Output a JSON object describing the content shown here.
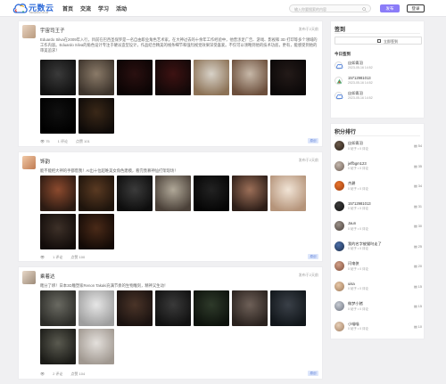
{
  "header": {
    "logo_title": "元数云",
    "logo_sub": "Metadata Cloud",
    "nav": [
      "首页",
      "交流",
      "学习",
      "活动"
    ],
    "search_placeholder": "输入你要搜索的内容",
    "publish_label": "发布",
    "login_label": "登录"
  },
  "posts": [
    {
      "user": "宇宙司王子",
      "date": "发布于2天前",
      "text": "Eduardo Silva在2009年入行，目前在巴西圣保罗是一名自由职业角色艺术家。在大神过去的十余年工作经验中，他曾涉足广告、游戏、影视和 3D 打印等多个领域的工作内容。Eduardo Silva的角色设计专注于硬派造型设计，作品结合精美的线条细节和强烈视觉效果深受喜爱。不仅可以领略到他的技术功底，更有，能感受到他的审美追求！",
      "views": "75",
      "comments": "1 评论",
      "likes": "点赞 101",
      "tag": "原创",
      "images": [
        [
          "#3a3a3a",
          "#111"
        ],
        [
          "#8a7a68",
          "#3d342c"
        ],
        [
          "#2a1010",
          "#0b0404"
        ],
        [
          "#3d1212",
          "#120808"
        ],
        [
          "#d8d2c8",
          "#8c7256"
        ],
        [
          "#c7b8a8",
          "#6c4f3c"
        ],
        [
          "#231a18",
          "#0b0808"
        ],
        [
          "#101010",
          "#000"
        ],
        [
          "#3a2818",
          "#0e0a08"
        ]
      ]
    },
    {
      "user": "饰韵",
      "date": "发布于2天前",
      "text": "能不能把大神的手都借我！AI出十位超唯美女角色建模，看完羡慕神仙打架现场！",
      "views": "",
      "comments": "1 评论",
      "likes": "点赞 100",
      "tag": "原创",
      "images": [
        [
          "#8c4a2e",
          "#2b1a12"
        ],
        [
          "#5a3a22",
          "#1e140c"
        ],
        [
          "#3b3b3b",
          "#0d0d0d"
        ],
        [
          "#b0a898",
          "#4a4038"
        ],
        [
          "#222",
          "#050505"
        ],
        [
          "#9c6f58",
          "#2d1e18"
        ],
        [
          "#f1e4d6",
          "#b5947a"
        ],
        [
          "#3d3028",
          "#120c0a"
        ],
        [
          "#4a2a18",
          "#130a06"
        ]
      ]
    },
    {
      "user": "乘着达",
      "date": "发布于2天前",
      "text": "瞎分了绑！日本3D雕塑家Renon Takaki充满节奏的生物雕刻，精神又生动！",
      "views": "",
      "comments": "2 评论",
      "likes": "点赞 104",
      "tag": "原创",
      "images": [
        [
          "#6a6a62",
          "#2c2c28"
        ],
        [
          "#e6e6e6",
          "#9e9e9e"
        ],
        [
          "#4a3428",
          "#1a1210"
        ],
        [
          "#3a3a3a",
          "#111"
        ],
        [
          "#2e3a2a",
          "#0d120c"
        ],
        [
          "#6e6058",
          "#2a221e"
        ],
        [
          "#3a4048",
          "#11161a"
        ],
        [
          "#5a5a50",
          "#1c1c18"
        ],
        [
          "#e4e0dc",
          "#a09890"
        ]
      ]
    }
  ],
  "signin": {
    "title": "签到",
    "button_label": "立即签到",
    "today_title": "今日签到",
    "items": [
      {
        "name": "自如青羽",
        "time": "2023-05-16 14:52"
      },
      {
        "name": "15712981013",
        "time": "2023-05-16 14:52"
      },
      {
        "name": "自如青羽",
        "time": "2023-05-16 14:52"
      }
    ]
  },
  "ranking": {
    "title": "积分排行",
    "items": [
      {
        "name": "自如青羽",
        "sub": "0 帖子 • 0 评论",
        "count": "54"
      },
      {
        "name": "jeffbgm123",
        "sub": "0 帖子 • 0 评论",
        "count": "35"
      },
      {
        "name": "杰爵",
        "sub": "0 帖子 • 0 评论",
        "count": "34"
      },
      {
        "name": "15712981013",
        "sub": "0 帖子 • 0 评论",
        "count": "31"
      },
      {
        "name": "Jaun",
        "sub": "0 帖子 • 0 评论",
        "count": "30"
      },
      {
        "name": "我的名字被猫叼走了",
        "sub": "0 帖子 • 0 评论",
        "count": "25"
      },
      {
        "name": "闪电侠",
        "sub": "0 帖子 • 0 评论",
        "count": "20"
      },
      {
        "name": "uisa",
        "sub": "0 帖子 • 0 评论",
        "count": "15"
      },
      {
        "name": "做梦小猪",
        "sub": "0 帖子 • 0 评论",
        "count": "15"
      },
      {
        "name": "小喵喵",
        "sub": "0 帖子 • 0 评论",
        "count": "10"
      }
    ]
  },
  "colors": {
    "accent": "#8b7cf8",
    "tag_bg": "#dde6fb",
    "tag_text": "#5b7fd8"
  }
}
